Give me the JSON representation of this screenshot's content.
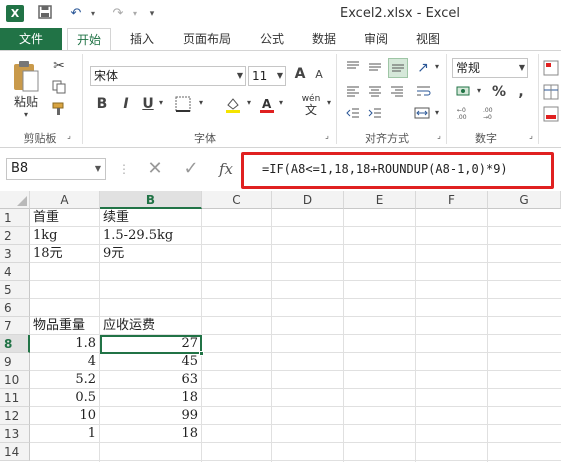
{
  "window": {
    "title": "Excel2.xlsx - Excel",
    "app_logo": "X"
  },
  "tabs": [
    "文件",
    "开始",
    "插入",
    "页面布局",
    "公式",
    "数据",
    "审阅",
    "视图"
  ],
  "ribbon": {
    "clipboard": {
      "paste_label": "粘贴",
      "group_label": "剪贴板"
    },
    "font": {
      "font_name": "宋体",
      "font_size": "11",
      "bold": "B",
      "italic": "I",
      "underline": "U",
      "wen_label": "wén",
      "wen_char": "文",
      "grow": "A",
      "shrink": "A",
      "group_label": "字体"
    },
    "alignment": {
      "group_label": "对齐方式"
    },
    "number": {
      "format": "常规",
      "percent": "%",
      "comma": ",",
      "group_label": "数字"
    }
  },
  "formula_bar": {
    "name_box": "B8",
    "cancel": "✕",
    "enter": "✓",
    "fx": "fx",
    "formula": "=IF(A8<=1,18,18+ROUNDUP(A8-1,0)*9)"
  },
  "sheet": {
    "columns": [
      "A",
      "B",
      "C",
      "D",
      "E",
      "F",
      "G"
    ],
    "rows": [
      "1",
      "2",
      "3",
      "4",
      "5",
      "6",
      "7",
      "8",
      "9",
      "10",
      "11",
      "12",
      "13",
      "14"
    ],
    "cells": {
      "A1": "首重",
      "B1": "续重",
      "A2": "1kg",
      "B2": "1.5-29.5kg",
      "A3": "18元",
      "B3": "9元",
      "A7": "物品重量",
      "B7": "应收运费",
      "A8": "1.8",
      "B8": "27",
      "A9": "4",
      "B9": "45",
      "A10": "5.2",
      "B10": "63",
      "A11": "0.5",
      "B11": "18",
      "A12": "10",
      "B12": "99",
      "A13": "1",
      "B13": "18"
    },
    "selected_cell": "B8"
  },
  "colors": {
    "excel_green": "#217346",
    "highlight_red": "#e02020"
  }
}
